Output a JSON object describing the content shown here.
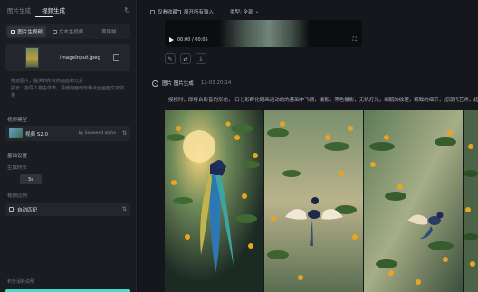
{
  "sidebar": {
    "top_tabs": [
      "图片生成",
      "视频生成"
    ],
    "active_tab_index": 1,
    "mode_tabs": [
      "图片生视频",
      "文本生视频",
      "首尾帧"
    ],
    "active_mode_index": 0,
    "upload": {
      "file_name": "imageInput.jpeg"
    },
    "hint": "描述图片，提供的所有的画面和元素",
    "hint_2": "提示：指导人物主体表，请使用面动作和点全画面文字效果",
    "video_model_label": "视频模型",
    "model": {
      "name": "视频 S2.0",
      "by": "by Seaweed alpha"
    },
    "basic_settings_label": "基础设置",
    "duration_label": "生成时长",
    "duration_value": "5s",
    "aspect_label": "视频比例",
    "aspect_value": "自动匹配",
    "bottom_label": "积分消耗说明"
  },
  "main": {
    "filters": {
      "f1": "仅看收藏",
      "f2": "展开所有输入",
      "f3": "类型: 全部"
    },
    "video": {
      "time": "00:00 / 00:05"
    },
    "message": {
      "title": "图片 图片生成",
      "time": "12-03 20:14"
    },
    "prompt": "授权时，即将合影音的形态，  口七彩群化铜画运动的的基础中飞翔，摄影，黑色摄影，无机灯光，细腻的纹理，精致的细节，超现代艺术，超高清晰度"
  },
  "icons": {
    "refresh": "refresh-icon",
    "edit": "edit-icon",
    "redo": "redo-icon",
    "download": "download-icon",
    "fullscreen": "fullscreen-icon",
    "play": "play-icon"
  },
  "colors": {
    "accent": "#4fd6c8",
    "background": "#111318",
    "panel": "#1a1c22"
  }
}
